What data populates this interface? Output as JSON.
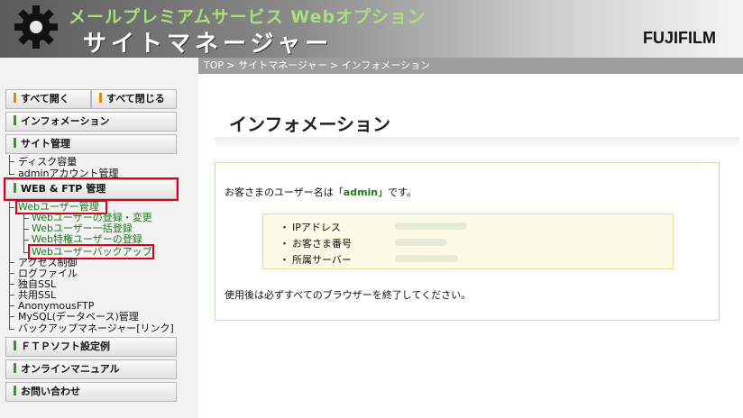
{
  "header": {
    "subtitle": "メールプレミアムサービス Webオプション",
    "title": "サイトマネージャー",
    "brand": "FUJIFILM"
  },
  "sidebar": {
    "open_all": "すべて開く",
    "close_all": "すべて閉じる",
    "information": "インフォメーション",
    "site_admin": {
      "label": "サイト管理",
      "items": [
        "ディスク容量",
        "adminアカウント管理"
      ]
    },
    "web_ftp": {
      "label": "WEB & FTP 管理",
      "web_user": "Webユーザー管理",
      "web_user_items": [
        "Webユーザーの登録・変更",
        "Webユーザー一括登録",
        "Web特権ユーザーの登録",
        "Webユーザーバックアップ"
      ],
      "items": [
        "アクセス制御",
        "ログファイル",
        "独自SSL",
        "共用SSL",
        "AnonymousFTP",
        "MySQL(データベース)管理",
        "バックアップマネージャー[リンク]"
      ]
    },
    "ftp_soft": "ＦＴＰソフト設定例",
    "online_manual": "オンラインマニュアル",
    "contact": "お問い合わせ"
  },
  "breadcrumb": "TOP > サイトマネージャー > インフォメーション",
  "main": {
    "title": "インフォメーション",
    "greeting_prefix": "お客さまのユーザー名は「",
    "username": "admin",
    "greeting_suffix": "」です。",
    "details": [
      {
        "bullet": "・",
        "label": "IPアドレス"
      },
      {
        "bullet": "・",
        "label": "お客さま番号"
      },
      {
        "bullet": "・",
        "label": "所属サーバー"
      }
    ],
    "note": "使用後は必ずすべてのブラウザーを終了してください。"
  },
  "colors": {
    "accent_green": "#2fa020",
    "accent_orange": "#e38a00",
    "highlight_red": "#d9001b",
    "link_green": "#1d7a1d"
  }
}
